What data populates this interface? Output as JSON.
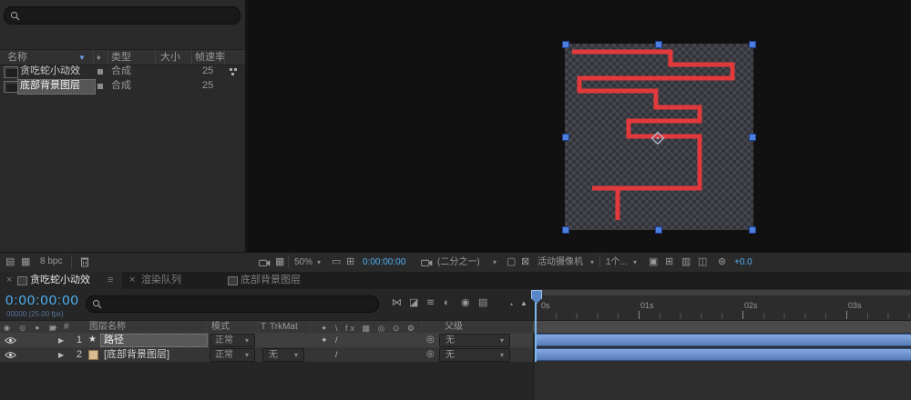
{
  "colors": {
    "timecode_blue": "#4fb1f3",
    "path_red": "#e23a3c",
    "handle_blue": "#4d7fe0",
    "layer_bar_blue": "#5b7fba"
  },
  "project_panel": {
    "columns": {
      "name": "名称",
      "type": "类型",
      "size": "大小",
      "framerate": "帧速率"
    },
    "items": [
      {
        "name": "贪吃蛇小动效",
        "type": "合成",
        "framerate": "25"
      },
      {
        "name": "底部背景图层",
        "type": "合成",
        "framerate": "25"
      }
    ],
    "footer": {
      "bpc": "8 bpc"
    }
  },
  "viewer_toolbar": {
    "zoom": "50%",
    "timecode": "0:00:00:00",
    "resolution": "(二分之一)",
    "camera": "活动摄像机",
    "views": "1个...",
    "exposure": "+0.0"
  },
  "timeline": {
    "tabs": [
      {
        "label": "贪吃蛇小动效"
      },
      {
        "label": "渲染队列"
      },
      {
        "label": "底部背景图层"
      }
    ],
    "timecode": "0:00:00:00",
    "frame_info": "00000 (25.00 fps)",
    "columns": {
      "number": "#",
      "layer_name": "图层名称",
      "mode": "模式",
      "trkmat_t": "T",
      "trkmat": "TrkMat",
      "parent": "父级"
    },
    "layers": [
      {
        "num": "1",
        "name": "路径",
        "mode": "正常",
        "parent": "无"
      },
      {
        "num": "2",
        "name": "[底部背景图层]",
        "mode": "正常",
        "trkmat": "无",
        "parent": "无"
      }
    ],
    "ruler_labels": [
      "0s",
      "01s",
      "02s",
      "03s"
    ]
  },
  "icons": {
    "sort_arrow": "▼",
    "chevron": "▾",
    "tag": "♦",
    "close": "×",
    "menu": "≡",
    "expand": "▶",
    "star": "★",
    "pickwhip": "◎",
    "av_header": "◉ ◎ ● ▣",
    "toggle_header": "✦ \\ fx ▦ ◎ ⊙ ⚙",
    "collapse": "✦",
    "quality_slash": "/",
    "snapshot_show": "▦",
    "guides": "▭",
    "grid": "⊞",
    "roi": "▢",
    "transp_grid": "⊠",
    "layout_a": "▣",
    "layout_b": "⊞",
    "layout_c": "▥",
    "pixel_aspect": "◫",
    "exposure_icon": "⊛",
    "mountain_small": "▴",
    "mountain_large": "▲",
    "tl1": "⋈",
    "tl2": "◪",
    "tl3": "≋",
    "tl4": "◐",
    "tl5": "◉",
    "tl6": "▤",
    "footer_a": "▤",
    "footer_b": "▦"
  }
}
